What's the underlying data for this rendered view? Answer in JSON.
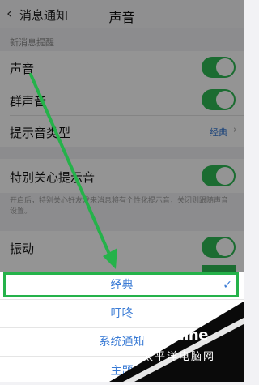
{
  "nav": {
    "back_label": "消息通知",
    "title": "声音"
  },
  "section_header": "新消息提醒",
  "rows": [
    {
      "label": "声音",
      "toggle": "on"
    },
    {
      "label": "群声音",
      "toggle": "on"
    },
    {
      "label": "提示音类型",
      "value": "经典"
    },
    {
      "label": "特别关心提示音",
      "toggle": "on"
    }
  ],
  "special_note": "开启后，特别关心好友发来消息将有个性化提示音，关闭则跟随声音设置。",
  "vibration": {
    "label": "振动",
    "toggle": "on"
  },
  "sheet": {
    "options": [
      {
        "label": "经典",
        "selected": true
      },
      {
        "label": "叮咚",
        "selected": false
      },
      {
        "label": "系统通知",
        "selected": false
      },
      {
        "label": "主题",
        "selected": false
      }
    ],
    "check_mark": "✓"
  },
  "watermark": {
    "brand": "PConline",
    "tagline": "太平洋电脑网"
  },
  "colors": {
    "toggle_on": "#2fba55",
    "accent": "#3a7bd5",
    "annotation": "#25b24a"
  }
}
